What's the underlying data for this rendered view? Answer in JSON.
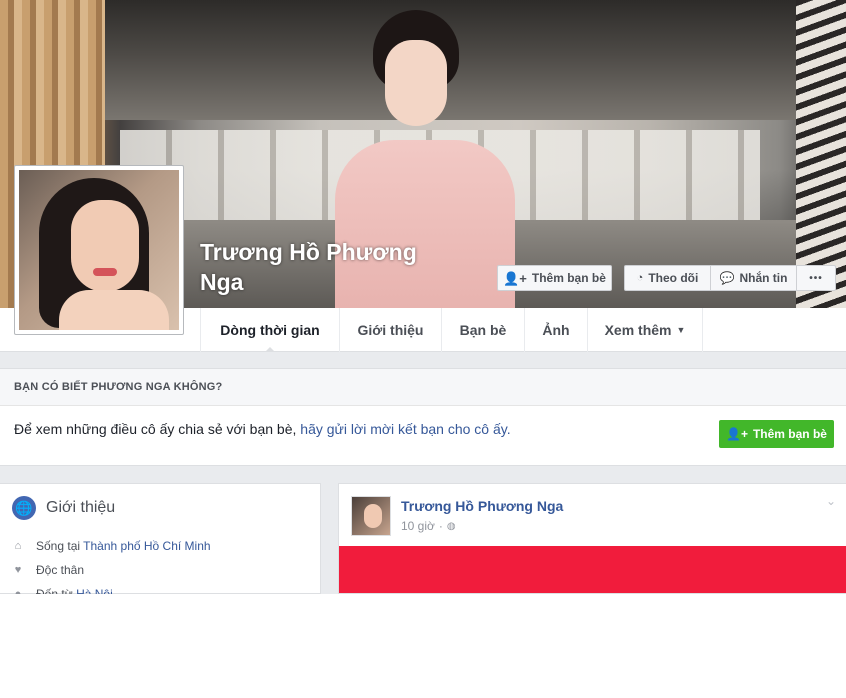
{
  "profile": {
    "name": "Trương Hồ Phương Nga"
  },
  "actions": {
    "add_friend": "Thêm bạn bè",
    "follow": "Theo dõi",
    "message": "Nhắn tin",
    "more": "•••"
  },
  "tabs": [
    {
      "label": "Dòng thời gian"
    },
    {
      "label": "Giới thiệu"
    },
    {
      "label": "Bạn bè"
    },
    {
      "label": "Ảnh"
    },
    {
      "label": "Xem thêm"
    }
  ],
  "know_box": {
    "heading": "BẠN CÓ BIẾT PHƯƠNG NGA KHÔNG?",
    "text": "Để xem những điều cô ấy chia sẻ với bạn bè, ",
    "link": "hãy gửi lời mời kết bạn cho cô ấy.",
    "button": "Thêm bạn bè"
  },
  "intro": {
    "title": "Giới thiệu",
    "items": [
      {
        "prefix": "Sống tại ",
        "link": "Thành phố Hồ Chí Minh",
        "icon": "home-icon"
      },
      {
        "prefix": "Độc thân",
        "link": "",
        "icon": "heart-icon"
      },
      {
        "prefix": "Đến từ ",
        "link": "Hà Nội",
        "icon": "location-pin-icon"
      }
    ]
  },
  "post": {
    "author": "Trương Hồ Phương Nga",
    "time": "10 giờ",
    "separator": "·"
  },
  "colors": {
    "facebook_blue": "#4267b2",
    "link_blue": "#365899",
    "green_button": "#42b72a",
    "post_media_red": "#f11c3c",
    "page_gray": "#e9ebee"
  }
}
